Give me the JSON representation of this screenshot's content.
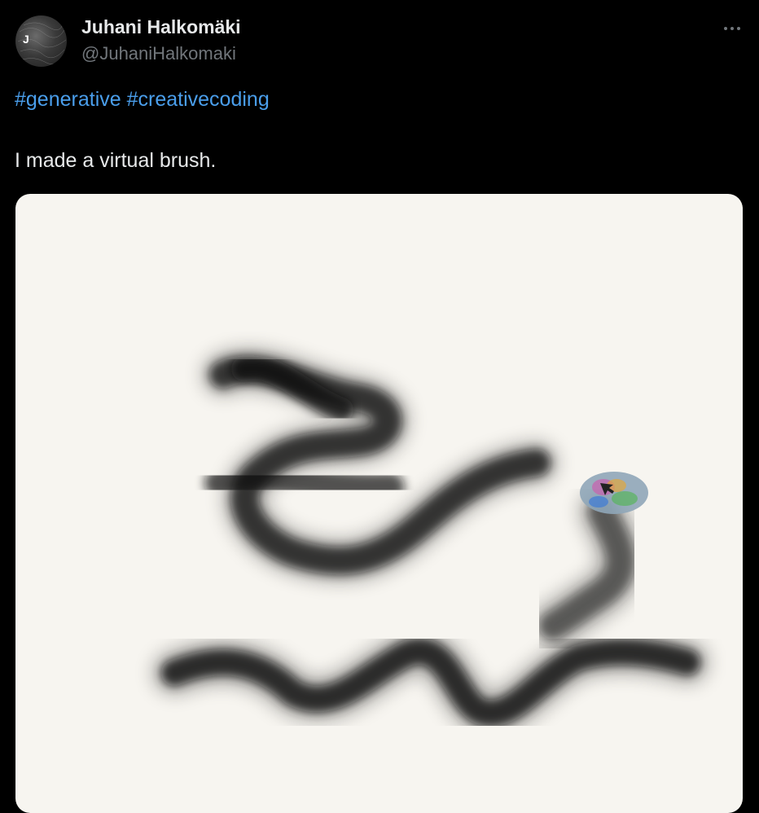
{
  "tweet": {
    "display_name": "Juhani Halkomäki",
    "handle": "@JuhaniHalkomaki",
    "avatar_letter": "J",
    "hashtags": [
      "#generative",
      "#creativecoding"
    ],
    "text": "I made a virtual brush.",
    "more_icon": "more-options-icon"
  },
  "media": {
    "description_icon": "brush-cursor-icon",
    "canvas_color": "#f7f5f0",
    "stroke_color": "#000000"
  },
  "colors": {
    "background": "#000000",
    "text_primary": "#e7e9ea",
    "text_secondary": "#71767b",
    "link": "#4a9eeb"
  }
}
